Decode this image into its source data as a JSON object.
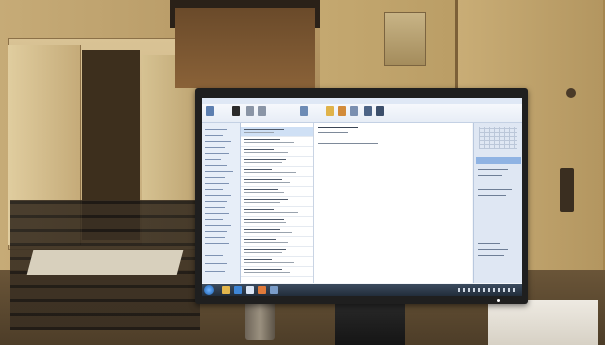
{
  "scene": {
    "description_tags": [
      "office",
      "monitor",
      "email-client"
    ],
    "colors": {
      "wall": "#b89a66",
      "screen_bg": "#f4f6f9",
      "ribbon": "#e7edf6",
      "selection": "#cfe0f5",
      "taskbar": "#2a3645"
    }
  },
  "monitor": {
    "icon": "monitor-icon",
    "screen": {
      "app": "email-client",
      "start_icon": "windows-start-icon",
      "taskbar_icons": [
        "folder-icon",
        "browser-icon",
        "mail-icon",
        "media-icon",
        "app-icon"
      ]
    }
  },
  "desk_items": {
    "mug_icon": "mug-icon",
    "tray_icon": "paper-tray-icon",
    "box_icon": "box-icon"
  }
}
